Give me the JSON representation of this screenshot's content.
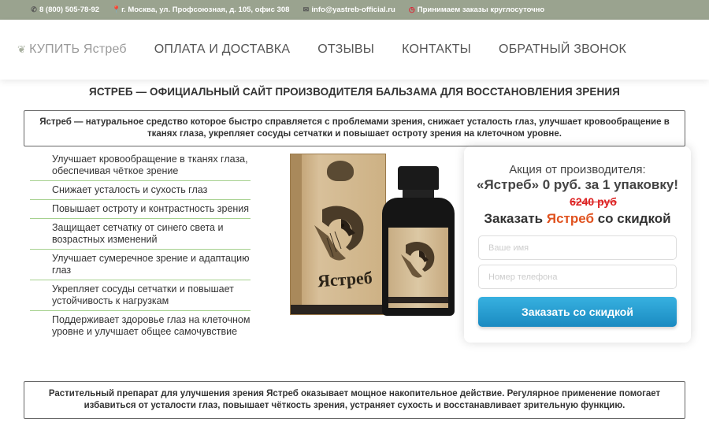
{
  "topbar": {
    "phone": "8 (800) 505-78-92",
    "address": "г. Москва, ул. Профсоюзная, д. 105, офис 308",
    "email": "info@yastreb-official.ru",
    "hours": "Принимаем заказы круглосуточно"
  },
  "nav": {
    "items": [
      {
        "label": "КУПИТЬ Ястреб",
        "icon": "leaf-icon"
      },
      {
        "label": "ОПЛАТА И ДОСТАВКА"
      },
      {
        "label": "ОТЗЫВЫ"
      },
      {
        "label": "КОНТАКТЫ"
      },
      {
        "label": "ОБРАТНЫЙ ЗВОНОК"
      }
    ]
  },
  "page": {
    "title": "ЯСТРЕБ — ОФИЦИАЛЬНЫЙ САЙТ ПРОИЗВОДИТЕЛЯ БАЛЬЗАМА ДЛЯ ВОССТАНОВЛЕНИЯ ЗРЕНИЯ",
    "intro": "Ястреб — натуральное средство которое быстро справляется с проблемами зрения, снижает усталость глаз, улучшает кровообращение в тканях глаза, укрепляет сосуды сетчатки и повышает остроту зрения на клеточном уровне.",
    "outro": "Растительный препарат для улучшения зрения Ястреб оказывает мощное накопительное действие. Регулярное применение помогает избавиться от усталости глаз, повышает чёткость зрения, устраняет сухость и восстанавливает зрительную функцию."
  },
  "benefits": [
    "Улучшает кровообращение в тканях глаза, обеспечивая чёткое зрение",
    "Снижает усталость и сухость глаз",
    "Повышает остроту и контрастность зрения",
    "Защищает сетчатку от синего света и возрастных изменений",
    "Улучшает сумеречное зрение и адаптацию глаз",
    "Укрепляет сосуды сетчатки и повышает устойчивость к нагрузкам",
    "Поддерживает здоровье глаз на клеточном уровне и улучшает общее самочувствие"
  ],
  "product": {
    "box_name": "Ястреб"
  },
  "order": {
    "promo_line1": "Акция от производителя:",
    "promo_line2": "«Ястреб» 0 руб. за 1 упаковку!",
    "old_price": "6240 руб",
    "title_prefix": "Заказать ",
    "title_accent": "Ястреб",
    "title_suffix": " со скидкой",
    "name_placeholder": "Ваше имя",
    "phone_placeholder": "Номер телефона",
    "submit_label": "Заказать со скидкой"
  },
  "colors": {
    "topbar_bg": "#9aa38f",
    "accent_orange": "#e0521f",
    "old_price_red": "#d22",
    "button_blue": "#1a8ac1",
    "divider_green": "#a6d18f"
  }
}
